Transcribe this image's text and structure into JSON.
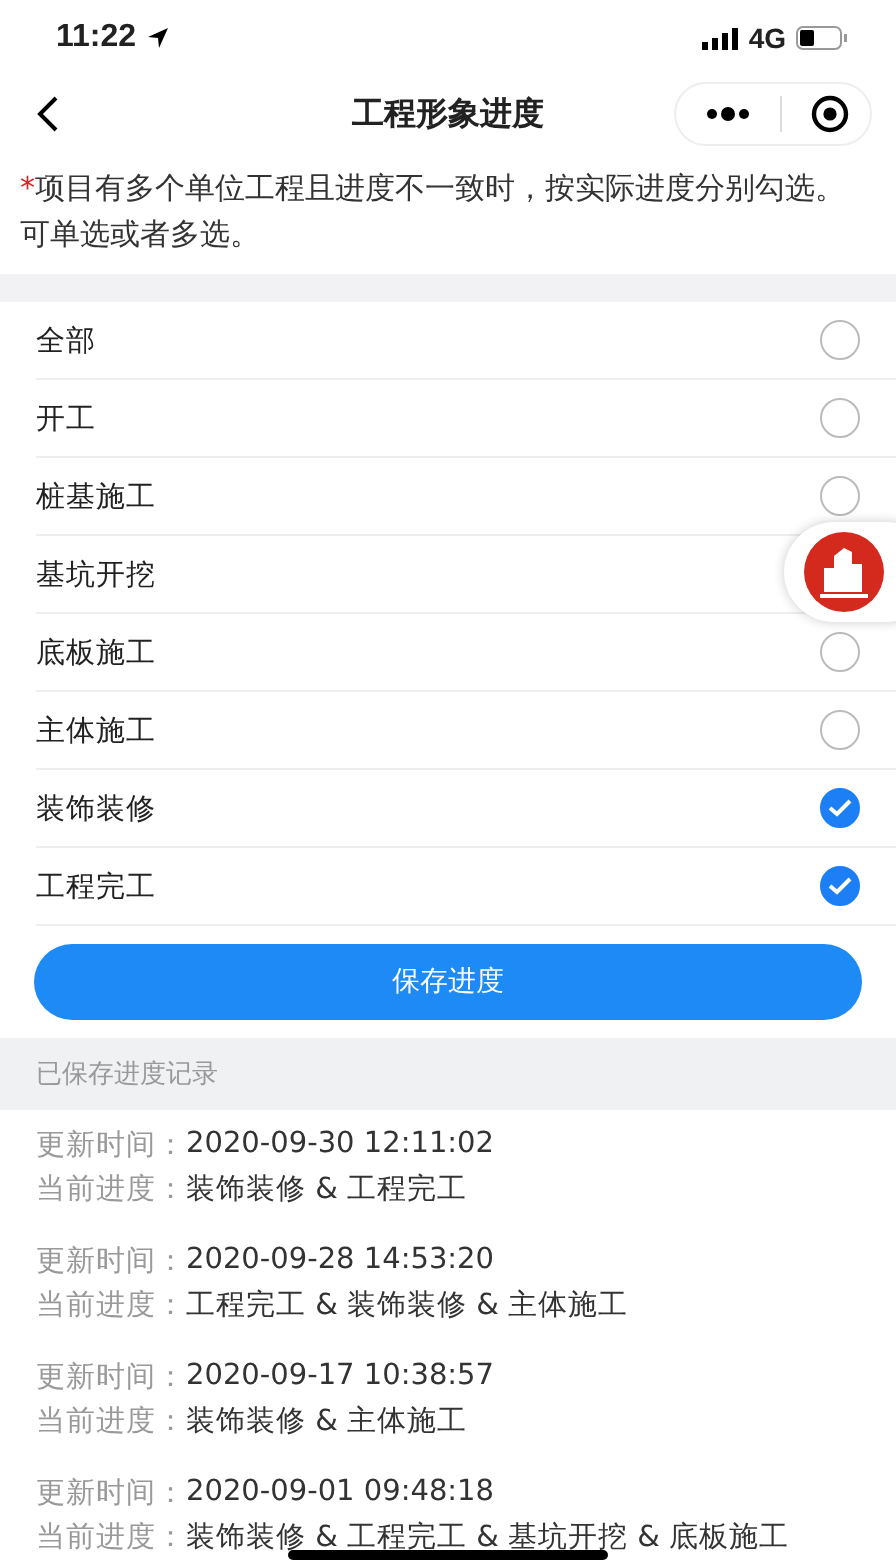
{
  "status_bar": {
    "time": "11:22",
    "network": "4G"
  },
  "nav": {
    "title": "工程形象进度"
  },
  "notice": {
    "mark": "*",
    "text": "项目有多个单位工程且进度不一致时，按实际进度分别勾选。可单选或者多选。"
  },
  "options": [
    {
      "label": "全部",
      "checked": false
    },
    {
      "label": "开工",
      "checked": false
    },
    {
      "label": "桩基施工",
      "checked": false
    },
    {
      "label": "基坑开挖"
    },
    {
      "label": "底板施工",
      "checked": false
    },
    {
      "label": "主体施工",
      "checked": false
    },
    {
      "label": "装饰装修",
      "checked": true
    },
    {
      "label": "工程完工",
      "checked": true
    }
  ],
  "save_button": "保存进度",
  "history": {
    "title": "已保存进度记录",
    "records": [
      {
        "time_label": "更新时间：",
        "time": "2020-09-30 12:11:02",
        "progress_label": "当前进度：",
        "progress": "装饰装修 & 工程完工"
      },
      {
        "time_label": "更新时间：",
        "time": "2020-09-28 14:53:20",
        "progress_label": "当前进度：",
        "progress": "工程完工 & 装饰装修 & 主体施工"
      },
      {
        "time_label": "更新时间：",
        "time": "2020-09-17 10:38:57",
        "progress_label": "当前进度：",
        "progress": "装饰装修 & 主体施工"
      },
      {
        "time_label": "更新时间：",
        "time": "2020-09-01 09:48:18",
        "progress_label": "当前进度：",
        "progress": "装饰装修 & 工程完工 & 基坑开挖 & 底板施工"
      }
    ]
  }
}
